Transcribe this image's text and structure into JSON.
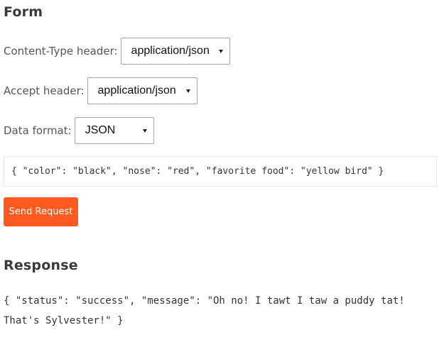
{
  "form": {
    "title": "Form",
    "content_type": {
      "label": "Content-Type header:",
      "value": "application/json"
    },
    "accept": {
      "label": "Accept header:",
      "value": "application/json"
    },
    "data_format": {
      "label": "Data format:",
      "value": "JSON"
    },
    "request_body": "{ \"color\": \"black\", \"nose\": \"red\", \"favorite food\": \"yellow bird\" }",
    "send_label": "Send Request"
  },
  "response": {
    "title": "Response",
    "body_line1": "{ \"status\": \"success\", \"message\": \"Oh no! I tawt I taw a puddy tat!",
    "body_line2": "That's Sylvester!\" }"
  },
  "colors": {
    "accent": "#ff5a1f",
    "heading": "#3a3a3a"
  }
}
